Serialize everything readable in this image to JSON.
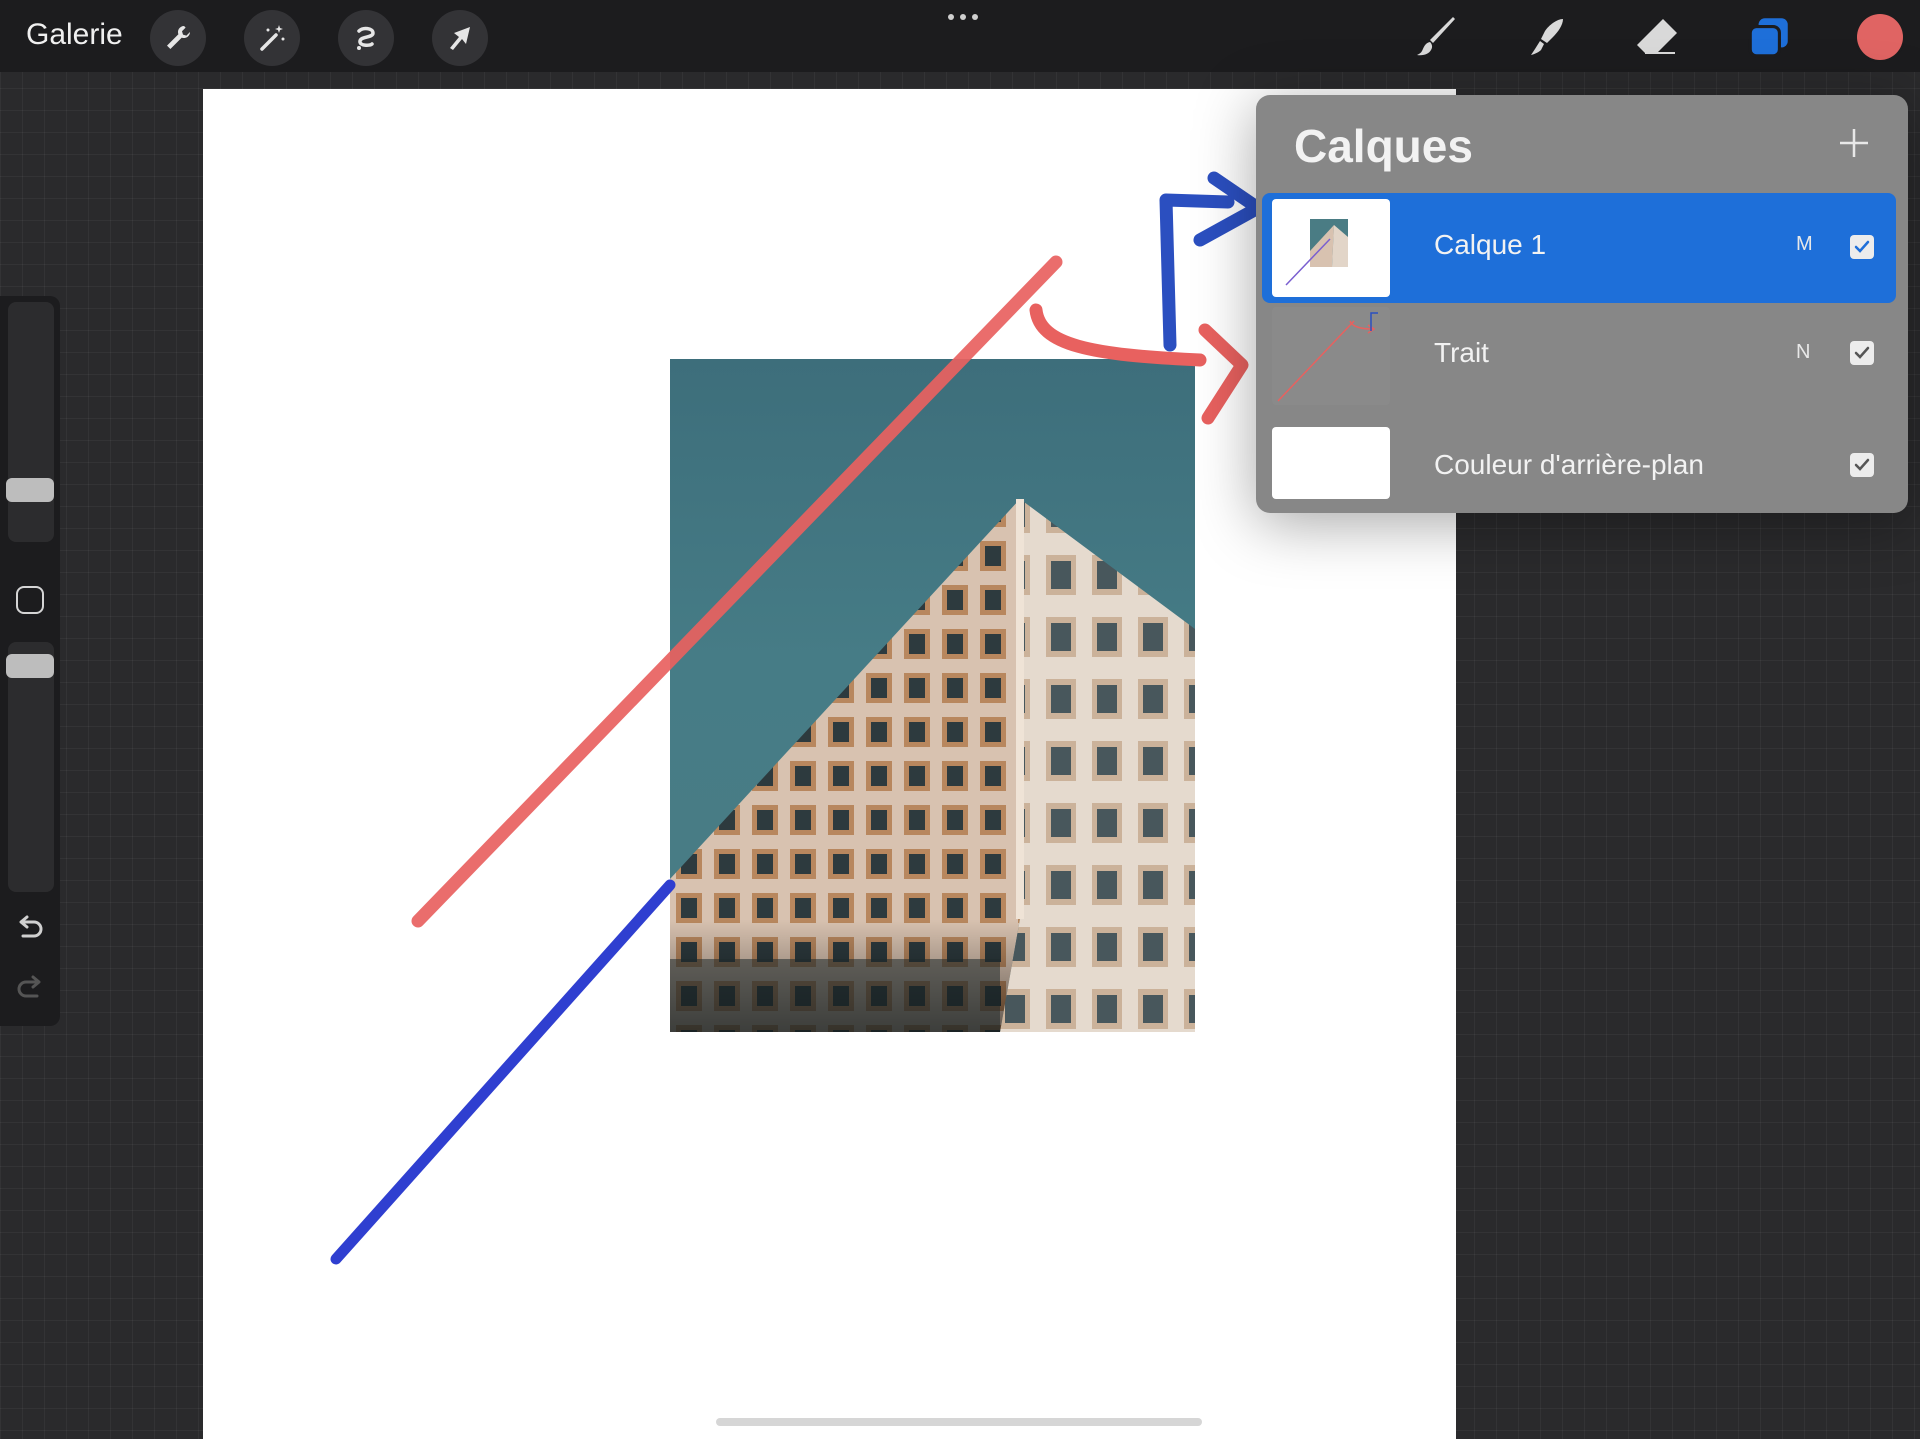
{
  "topbar": {
    "gallery_label": "Galerie",
    "left_tools": [
      {
        "icon": "wrench-icon",
        "name": "actions-button"
      },
      {
        "icon": "magic-wand-icon",
        "name": "adjustments-button"
      },
      {
        "icon": "selection-icon",
        "name": "selection-button"
      },
      {
        "icon": "transform-arrow-icon",
        "name": "transform-button"
      }
    ],
    "more_icon": "more-dots-icon",
    "right_tools": [
      {
        "icon": "brush-icon",
        "name": "brush-button"
      },
      {
        "icon": "smudge-icon",
        "name": "smudge-button"
      },
      {
        "icon": "eraser-icon",
        "name": "eraser-button"
      },
      {
        "icon": "layers-icon",
        "name": "layers-button"
      }
    ],
    "current_color": "#e06463",
    "accent_color": "#1e6fd9"
  },
  "sidebar": {
    "brush_size_level": 0.18,
    "opacity_level": 0.32,
    "undo_icon": "undo-icon",
    "redo_icon": "redo-icon"
  },
  "layers_panel": {
    "title": "Calques",
    "add_icon": "plus-icon",
    "layers": [
      {
        "name": "Calque 1",
        "mode": "M",
        "visible": true,
        "active": true
      },
      {
        "name": "Trait",
        "mode": "N",
        "visible": true,
        "active": false
      },
      {
        "name": "Couleur d'arrière-plan",
        "mode": "",
        "visible": true,
        "active": false
      }
    ]
  },
  "annotations": {
    "red_color": "#e8615f",
    "blue_color": "#2f3fd0",
    "arrow_blue_color": "#2b4fc0"
  }
}
